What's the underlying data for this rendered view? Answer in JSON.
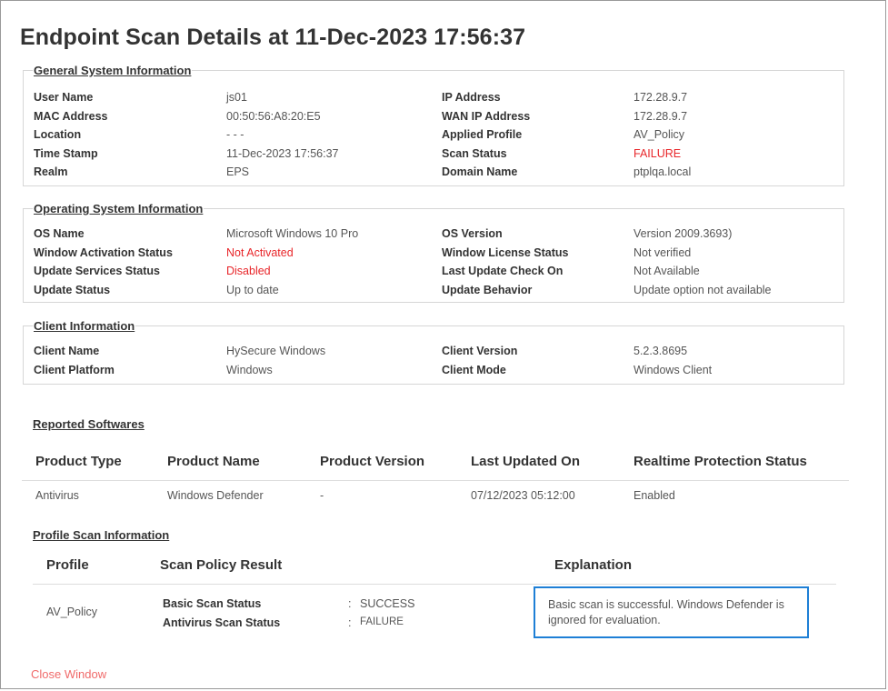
{
  "page": {
    "title": "Endpoint Scan Details at 11-Dec-2023 17:56:37",
    "close_label": "Close Window"
  },
  "general": {
    "legend": "General System Information",
    "left": [
      {
        "label": "User Name",
        "value": "js01"
      },
      {
        "label": "MAC Address",
        "value": "00:50:56:A8:20:E5"
      },
      {
        "label": "Location",
        "value": "- - -"
      },
      {
        "label": "Time Stamp",
        "value": "11-Dec-2023 17:56:37"
      },
      {
        "label": "Realm",
        "value": "EPS"
      }
    ],
    "right": [
      {
        "label": "IP Address",
        "value": "172.28.9.7"
      },
      {
        "label": "WAN IP Address",
        "value": "172.28.9.7"
      },
      {
        "label": "Applied Profile",
        "value": "AV_Policy"
      },
      {
        "label": "Scan Status",
        "value": "FAILURE"
      },
      {
        "label": "Domain Name",
        "value": "ptplqa.local"
      }
    ]
  },
  "os": {
    "legend": "Operating System Information",
    "left": [
      {
        "label": "OS Name",
        "value": "Microsoft Windows 10 Pro"
      },
      {
        "label": "Window Activation Status",
        "value": "Not Activated"
      },
      {
        "label": "Update Services Status",
        "value": "Disabled"
      },
      {
        "label": "Update Status",
        "value": "Up to date"
      }
    ],
    "right": [
      {
        "label": "OS Version",
        "value": "Version 2009.3693)"
      },
      {
        "label": "Window License Status",
        "value": "Not verified"
      },
      {
        "label": "Last Update Check On",
        "value": "Not Available"
      },
      {
        "label": "Update Behavior",
        "value": "Update option not available"
      }
    ]
  },
  "client": {
    "legend": "Client Information",
    "left": [
      {
        "label": "Client Name",
        "value": "HySecure Windows"
      },
      {
        "label": "Client Platform",
        "value": "Windows"
      }
    ],
    "right": [
      {
        "label": "Client Version",
        "value": "5.2.3.8695"
      },
      {
        "label": "Client Mode",
        "value": "Windows Client"
      }
    ]
  },
  "software": {
    "title": "Reported Softwares",
    "headers": [
      "Product Type",
      "Product Name",
      "Product Version",
      "Last Updated On",
      "Realtime Protection Status"
    ],
    "rows": [
      [
        "Antivirus",
        "Windows Defender",
        "-",
        "07/12/2023 05:12:00",
        "Enabled"
      ]
    ]
  },
  "profile_scan": {
    "title": "Profile Scan Information",
    "headers": [
      "Profile",
      "Scan Policy Result",
      "Explanation"
    ],
    "profile": "AV_Policy",
    "results": [
      {
        "label": "Basic Scan Status",
        "sep": ":",
        "value": "SUCCESS"
      },
      {
        "label": "Antivirus Scan Status",
        "sep": ":",
        "value": "FAILURE"
      }
    ],
    "explanation": "Basic scan is successful. Windows Defender is ignored for evaluation."
  },
  "colors": {
    "failure": "#e8262a",
    "success": "#1f8a1f",
    "highlight_border": "#1e7fd6",
    "link": "#f06a6a"
  }
}
